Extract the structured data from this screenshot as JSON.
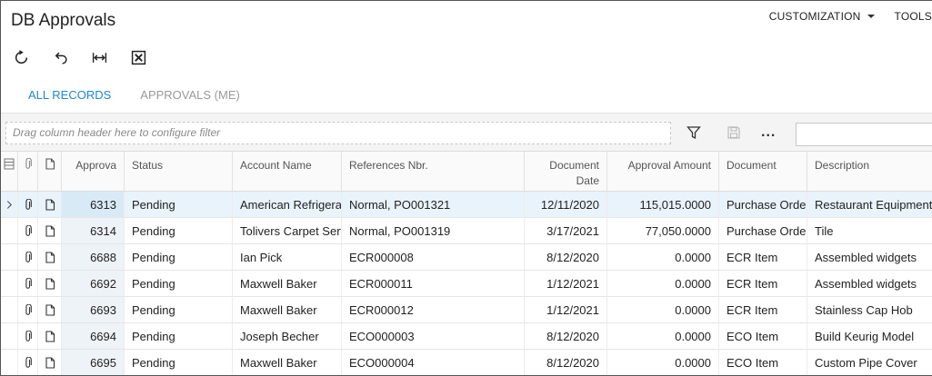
{
  "page": {
    "title": "DB Approvals",
    "menu": {
      "customization": "CUSTOMIZATION",
      "tools": "TOOLS"
    }
  },
  "toolbar": {
    "icons": [
      "refresh-icon",
      "undo-icon",
      "fit-columns-icon",
      "excel-export-icon"
    ]
  },
  "tabs": [
    {
      "label": "ALL RECORDS",
      "active": true
    },
    {
      "label": "APPROVALS (ME)",
      "active": false
    }
  ],
  "filter": {
    "placeholder": "Drag column header here to configure filter",
    "more_label": "..."
  },
  "grid": {
    "columns": {
      "approval": "Approva",
      "status": "Status",
      "account": "Account Name",
      "refnbr": "References Nbr.",
      "docdate": "Document Date",
      "amount": "Approval Amount",
      "document": "Document",
      "description": "Description"
    },
    "rows": [
      {
        "id": "6313",
        "status": "Pending",
        "account": "American Refrigeration",
        "ref": "Normal, PO001321",
        "date": "12/11/2020",
        "amount": "115,015.0000",
        "document": "Purchase Order",
        "description": "Restaurant Equipment"
      },
      {
        "id": "6314",
        "status": "Pending",
        "account": "Tolivers Carpet Service",
        "ref": "Normal, PO001319",
        "date": "3/17/2021",
        "amount": "77,050.0000",
        "document": "Purchase Order",
        "description": "Tile"
      },
      {
        "id": "6688",
        "status": "Pending",
        "account": "Ian Pick",
        "ref": "ECR000008",
        "date": "8/12/2020",
        "amount": "0.0000",
        "document": "ECR Item",
        "description": "Assembled widgets"
      },
      {
        "id": "6692",
        "status": "Pending",
        "account": "Maxwell Baker",
        "ref": "ECR000011",
        "date": "1/12/2021",
        "amount": "0.0000",
        "document": "ECR Item",
        "description": "Assembled widgets"
      },
      {
        "id": "6693",
        "status": "Pending",
        "account": "Maxwell Baker",
        "ref": "ECR000012",
        "date": "1/12/2021",
        "amount": "0.0000",
        "document": "ECR Item",
        "description": "Stainless Cap Hob"
      },
      {
        "id": "6694",
        "status": "Pending",
        "account": "Joseph Becher",
        "ref": "ECO000003",
        "date": "8/12/2020",
        "amount": "0.0000",
        "document": "ECO Item",
        "description": "Build Keurig Model"
      },
      {
        "id": "6695",
        "status": "Pending",
        "account": "Maxwell Baker",
        "ref": "ECO000004",
        "date": "8/12/2020",
        "amount": "0.0000",
        "document": "ECO Item",
        "description": "Custom Pipe Cover"
      }
    ]
  },
  "colors": {
    "accent": "#1e88d2",
    "selected_row": "#e9f3fb"
  }
}
